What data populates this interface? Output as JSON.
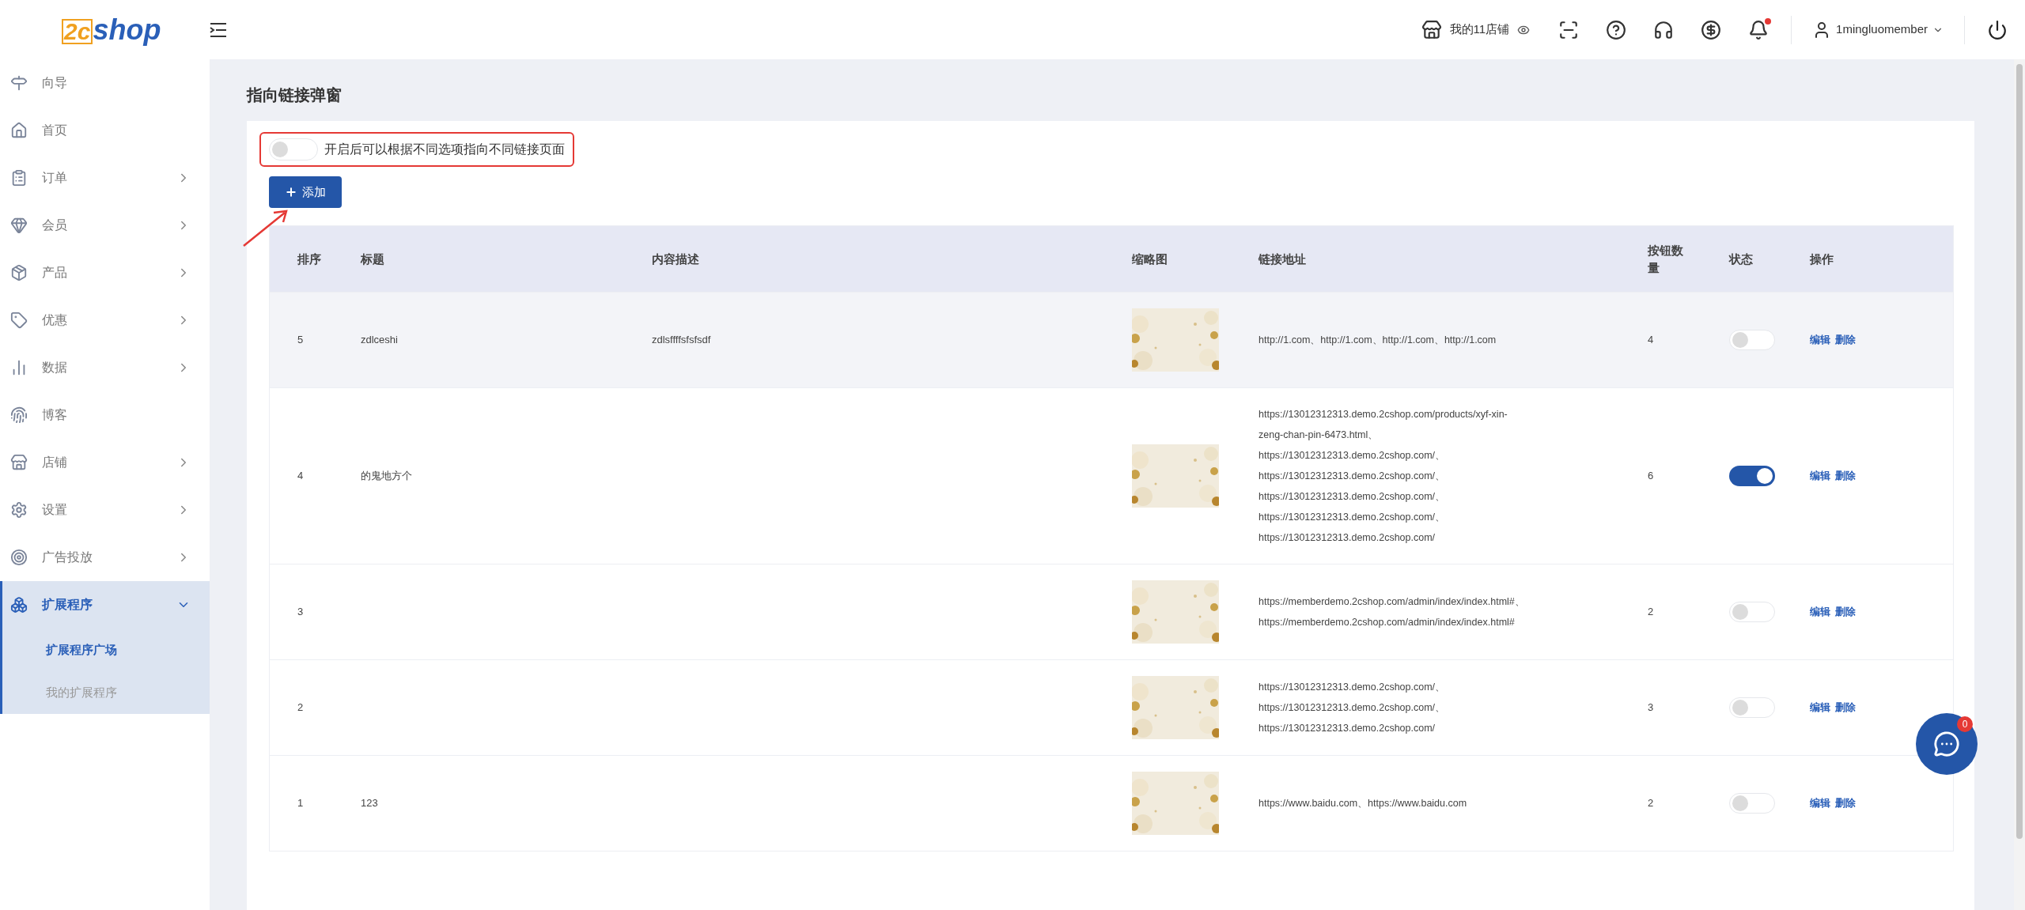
{
  "header": {
    "logo": {
      "mark": "2c",
      "text": "shop"
    },
    "store": "我的11店铺",
    "user": "1mingluomember",
    "notification_dot": true
  },
  "sidebar": {
    "items": [
      {
        "label": "向导",
        "expandable": false,
        "expanded": false,
        "selected": false
      },
      {
        "label": "首页",
        "expandable": false,
        "expanded": false,
        "selected": false
      },
      {
        "label": "订单",
        "expandable": true,
        "expanded": false,
        "selected": false
      },
      {
        "label": "会员",
        "expandable": true,
        "expanded": false,
        "selected": false
      },
      {
        "label": "产品",
        "expandable": true,
        "expanded": false,
        "selected": false
      },
      {
        "label": "优惠",
        "expandable": true,
        "expanded": false,
        "selected": false
      },
      {
        "label": "数据",
        "expandable": true,
        "expanded": false,
        "selected": false
      },
      {
        "label": "博客",
        "expandable": false,
        "expanded": false,
        "selected": false
      },
      {
        "label": "店铺",
        "expandable": true,
        "expanded": false,
        "selected": false
      },
      {
        "label": "设置",
        "expandable": true,
        "expanded": false,
        "selected": false
      },
      {
        "label": "广告投放",
        "expandable": true,
        "expanded": false,
        "selected": false
      },
      {
        "label": "扩展程序",
        "expandable": true,
        "expanded": true,
        "selected": true,
        "children": [
          {
            "label": "扩展程序广场",
            "selected": true
          },
          {
            "label": "我的扩展程序",
            "selected": false
          }
        ]
      }
    ]
  },
  "page": {
    "title": "指向链接弹窗",
    "toggle": {
      "label": "开启后可以根据不同选项指向不同链接页面",
      "on": false,
      "highlighted": true
    },
    "add_button": {
      "label": "添加"
    }
  },
  "table": {
    "columns": [
      "排序",
      "标题",
      "内容描述",
      "缩略图",
      "链接地址",
      "按钮数量",
      "状态",
      "操作"
    ],
    "rows": [
      {
        "order": "5",
        "title": "zdlceshi",
        "description": "zdlsffffsfsfsdf",
        "thumbnail": {
          "kind": "picture"
        },
        "link_lines": [
          "http://1.com、http://1.com、http://1.com、http://1.com"
        ],
        "button_count": "4",
        "enabled": false,
        "hovered": true,
        "actions": [
          "编辑",
          "删除"
        ]
      },
      {
        "order": "4",
        "title": "的鬼地方个",
        "thumbnail": {
          "kind": "picture"
        },
        "link_lines": [
          "https://13012312313.demo.2cshop.com/products/xyf-xin-",
          "zeng-chan-pin-6473.html、",
          "https://13012312313.demo.2cshop.com/、",
          "https://13012312313.demo.2cshop.com/、",
          "https://13012312313.demo.2cshop.com/、",
          "https://13012312313.demo.2cshop.com/、",
          "https://13012312313.demo.2cshop.com/"
        ],
        "button_count": "6",
        "enabled": true,
        "hovered": false,
        "actions": [
          "编辑",
          "删除"
        ]
      },
      {
        "order": "3",
        "thumbnail": {
          "kind": "picture"
        },
        "link_lines": [
          "https://memberdemo.2cshop.com/admin/index/index.html#、",
          "https://memberdemo.2cshop.com/admin/index/index.html#"
        ],
        "button_count": "2",
        "enabled": false,
        "hovered": false,
        "actions": [
          "编辑",
          "删除"
        ]
      },
      {
        "order": "2",
        "thumbnail": {
          "kind": "picture"
        },
        "link_lines": [
          "https://13012312313.demo.2cshop.com/、",
          "https://13012312313.demo.2cshop.com/、",
          "https://13012312313.demo.2cshop.com/"
        ],
        "button_count": "3",
        "enabled": false,
        "hovered": false,
        "actions": [
          "编辑",
          "删除"
        ]
      },
      {
        "order": "1",
        "title": "123",
        "thumbnail": {
          "kind": "picture"
        },
        "link_lines": [
          "https://www.baidu.com、https://www.baidu.com"
        ],
        "button_count": "2",
        "enabled": false,
        "hovered": false,
        "actions": [
          "编辑",
          "删除"
        ]
      }
    ]
  },
  "chat": {
    "badge": "0"
  }
}
